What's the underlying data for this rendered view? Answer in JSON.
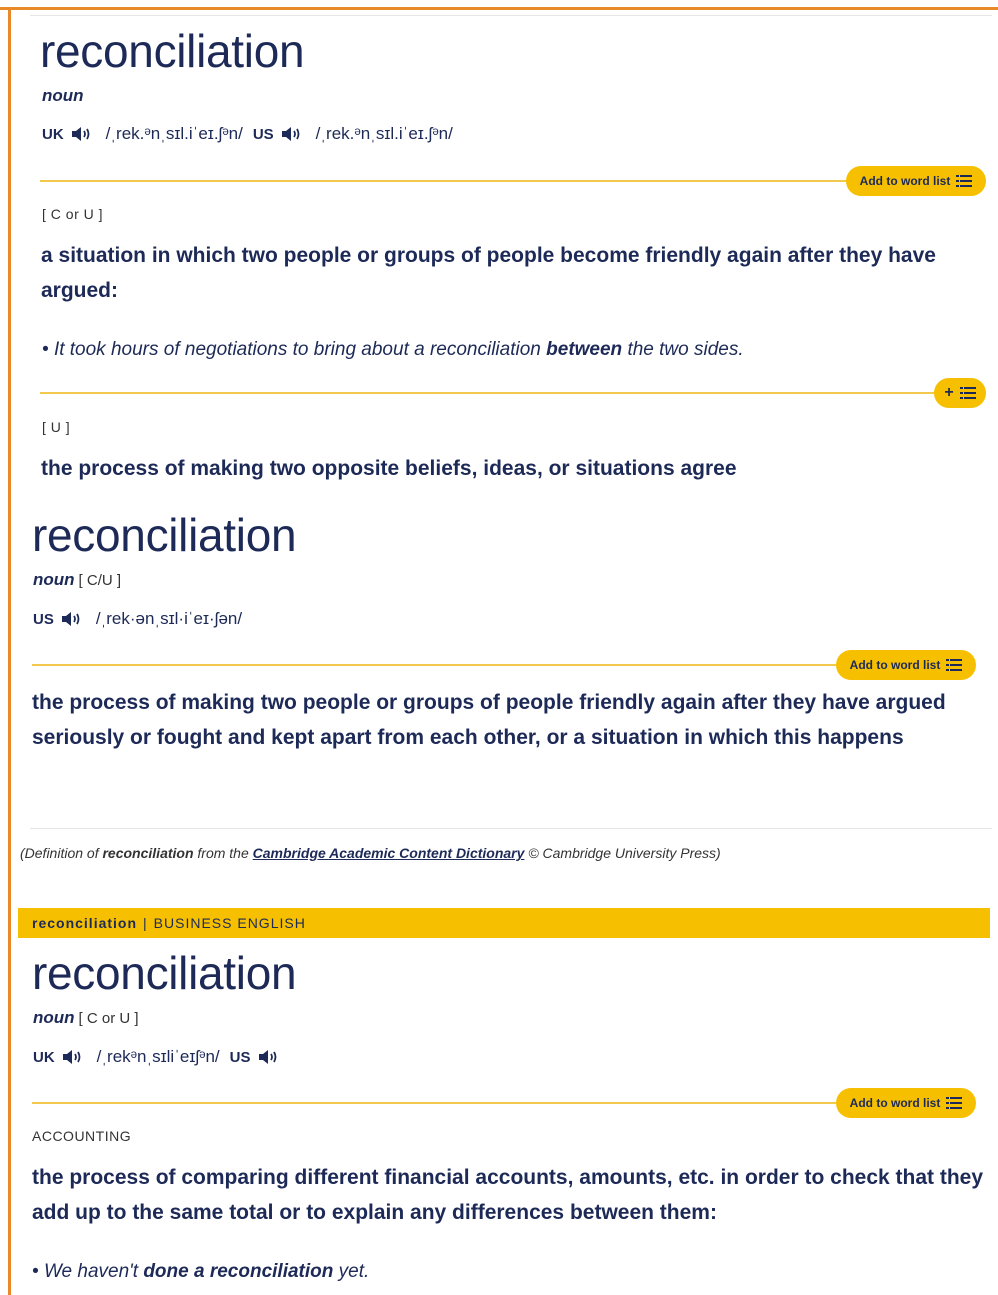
{
  "entry1": {
    "headword": "reconciliation",
    "pos": "noun",
    "uk_label": "UK",
    "uk_ipa": "/ˌrek.ᵊnˌsɪl.iˈeɪ.ʃᵊn/",
    "us_label": "US",
    "us_ipa": "/ˌrek.ᵊnˌsɪl.iˈeɪ.ʃᵊn/",
    "wordlist_label": "Add to word list",
    "sense1": {
      "grammar": "[ C or U ]",
      "definition": "a situation in which two people or groups of people become friendly again after they have argued:",
      "example_pre": "It took hours of negotiations to bring about a reconciliation",
      "example_bold": "between",
      "example_post": "the two sides."
    },
    "plus_label": "+",
    "sense2": {
      "grammar": "[ U ]",
      "definition": "the process of making two opposite beliefs, ideas, or situations agree"
    }
  },
  "entry2": {
    "headword": "reconciliation",
    "pos": "noun",
    "grammar": "[ C/U ]",
    "us_label": "US",
    "us_ipa": "/ˌrek·ənˌsɪl·iˈeɪ·ʃən/",
    "wordlist_label": "Add to word list",
    "definition": "the process of making two people or groups of people friendly again after they have argued seriously or fought and kept apart from each other, or a situation in which this happens"
  },
  "credit": {
    "pre": "(Definition of",
    "word": "reconciliation",
    "mid": "from the",
    "dictionary": "Cambridge Academic Content Dictionary",
    "post": "© Cambridge University Press)"
  },
  "business": {
    "banner_word": "reconciliation",
    "banner_sep": "|",
    "banner_section": "BUSINESS ENGLISH",
    "headword": "reconciliation",
    "pos": "noun",
    "grammar": "[ C or U ]",
    "uk_label": "UK",
    "uk_ipa": "/ˌrekᵊnˌsɪliˈeɪʃᵊn/",
    "us_label": "US",
    "wordlist_label": "Add to word list",
    "domain": "ACCOUNTING",
    "definition": "the process of comparing different financial accounts, amounts, etc. in order to check that they add up to the same total or to explain any differences between them:",
    "example_pre": "We haven't",
    "example_bold": "done a reconciliation",
    "example_post": "yet."
  },
  "colors": {
    "accent": "#f6c000",
    "text": "#1d2a57",
    "frame": "#e8892a",
    "rule": "#f2c94c"
  },
  "icons": {
    "audio": "speaker-icon",
    "wordlist": "list-icon"
  }
}
